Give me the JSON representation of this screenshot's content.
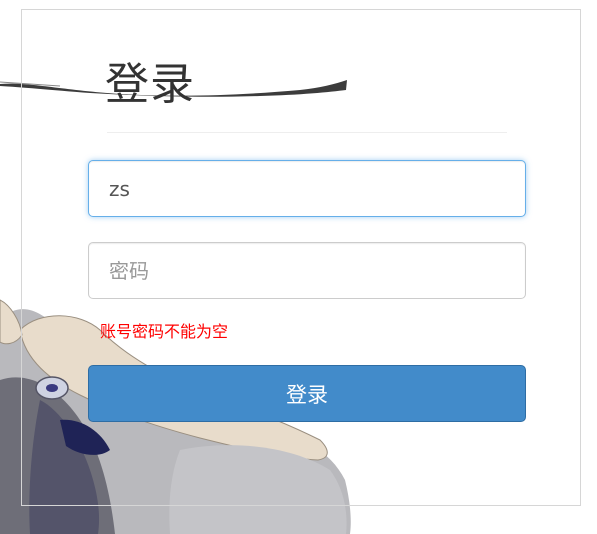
{
  "login": {
    "title": "登录",
    "username": {
      "value": "zs"
    },
    "password": {
      "value": "",
      "placeholder": "密码"
    },
    "error_message": "账号密码不能为空",
    "submit_label": "登录"
  },
  "colors": {
    "button_bg": "#428bca",
    "error_text": "#ff0000",
    "focus_border": "#66afe9"
  }
}
